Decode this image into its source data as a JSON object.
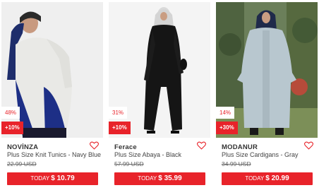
{
  "products": [
    {
      "discount": "48%",
      "extra": "+10%",
      "brand": "NOVİNZA",
      "name": "Plus Size Knit Tunics - Navy Blue",
      "old_price": "22.99 USD",
      "today_label": "TODAY",
      "today_price": "$ 10.79",
      "image_icon": "model-photo-tunic"
    },
    {
      "discount": "31%",
      "extra": "+10%",
      "brand": "Ferace",
      "name": "Plus Size Abaya - Black",
      "old_price": "57.99 USD",
      "today_label": "TODAY",
      "today_price": "$ 35.99",
      "image_icon": "model-photo-abaya"
    },
    {
      "discount": "14%",
      "extra": "+30%",
      "brand": "MODANUR",
      "name": "Plus Size Cardigans - Gray",
      "old_price": "34.99 USD",
      "today_label": "TODAY",
      "today_price": "$ 20.99",
      "image_icon": "model-photo-cardigan"
    }
  ],
  "colors": {
    "accent": "#e8232a",
    "text": "#333333"
  }
}
